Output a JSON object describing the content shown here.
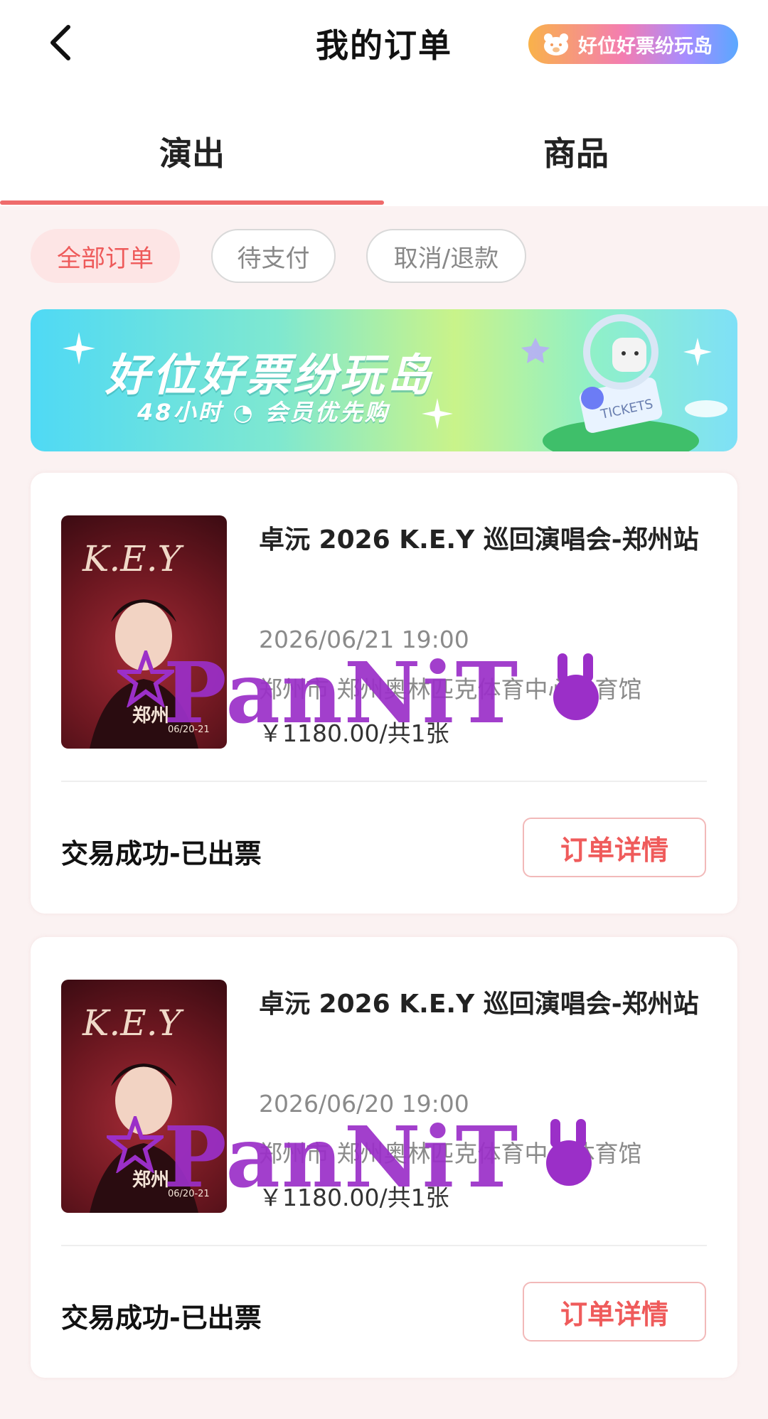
{
  "header": {
    "title": "我的订单",
    "island_label": "好位好票纷玩岛"
  },
  "tabs": [
    {
      "label": "演出"
    },
    {
      "label": "商品"
    }
  ],
  "filters": [
    {
      "label": "全部订单"
    },
    {
      "label": "待支付"
    },
    {
      "label": "取消/退款"
    }
  ],
  "banner": {
    "title": "好位好票纷玩岛",
    "subtitle": "48小时 ◔ 会员优先购"
  },
  "orders": [
    {
      "title": "卓沅 2026 K.E.Y 巡回演唱会-郑州站",
      "datetime": "2026/06/21 19:00",
      "venue": "郑州市 郑州奥林匹克体育中心体育馆",
      "price": "￥1180.00/共1张",
      "status": "交易成功-已出票",
      "detail_label": "订单详情",
      "poster_text": "K.E.Y",
      "poster_city": "郑州",
      "poster_dates": "06/20-21"
    },
    {
      "title": "卓沅 2026 K.E.Y 巡回演唱会-郑州站",
      "datetime": "2026/06/20 19:00",
      "venue": "郑州市 郑州奥林匹克体育中心体育馆",
      "price": "￥1180.00/共1张",
      "status": "交易成功-已出票",
      "detail_label": "订单详情",
      "poster_text": "K.E.Y",
      "poster_city": "郑州",
      "poster_dates": "06/20-21"
    }
  ],
  "watermark": "PanNiT"
}
